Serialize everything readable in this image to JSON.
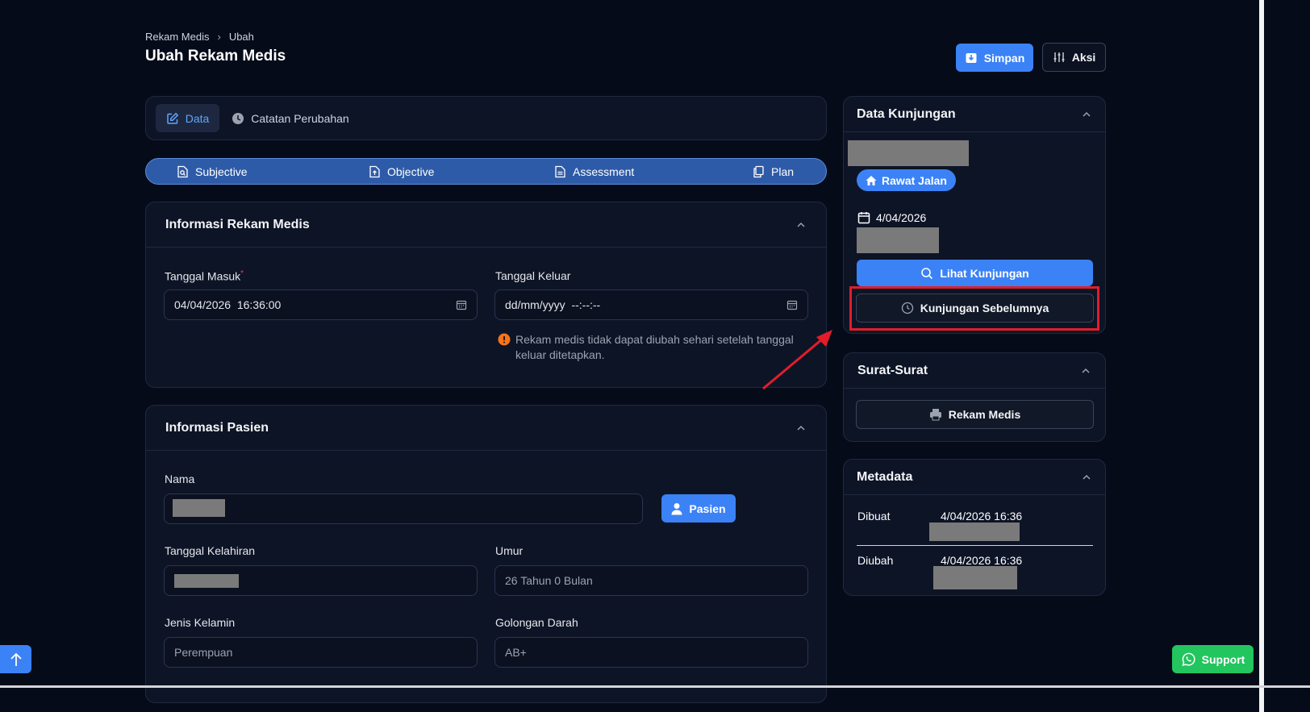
{
  "breadcrumb": {
    "root": "Rekam Medis",
    "current": "Ubah"
  },
  "page_title": "Ubah Rekam Medis",
  "header_actions": {
    "save": "Simpan",
    "actions": "Aksi"
  },
  "tabs": {
    "data": "Data",
    "changelog": "Catatan Perubahan"
  },
  "soap": {
    "subjective": "Subjective",
    "objective": "Objective",
    "assessment": "Assessment",
    "plan": "Plan"
  },
  "record_info": {
    "title": "Informasi Rekam Medis",
    "entry_label": "Tanggal Masuk",
    "required_mark": "*",
    "entry_value": "04/04/2026  16:36:00",
    "exit_label": "Tanggal Keluar",
    "exit_placeholder": "dd/mm/yyyy  --:--:--",
    "warning": "Rekam medis tidak dapat diubah sehari setelah tanggal keluar ditetapkan."
  },
  "patient_info": {
    "title": "Informasi Pasien",
    "name_label": "Nama",
    "patient_button": "Pasien",
    "birth_label": "Tanggal Kelahiran",
    "age_label": "Umur",
    "age_value": "26 Tahun 0 Bulan",
    "gender_label": "Jenis Kelamin",
    "gender_value": "Perempuan",
    "blood_label": "Golongan Darah",
    "blood_value": "AB+"
  },
  "visit": {
    "title": "Data Kunjungan",
    "type_badge": "Rawat Jalan",
    "date": "4/04/2026",
    "view_button": "Lihat Kunjungan",
    "previous_button": "Kunjungan Sebelumnya"
  },
  "letters": {
    "title": "Surat-Surat",
    "record_button": "Rekam Medis"
  },
  "metadata": {
    "title": "Metadata",
    "created_label": "Dibuat",
    "created_value": "4/04/2026 16:36",
    "updated_label": "Diubah",
    "updated_value": "4/04/2026 16:36"
  },
  "support": "Support",
  "colors": {
    "accent": "#3b82f6",
    "annotation": "#e11d2a",
    "support": "#22c55e",
    "warning": "#f97316"
  }
}
